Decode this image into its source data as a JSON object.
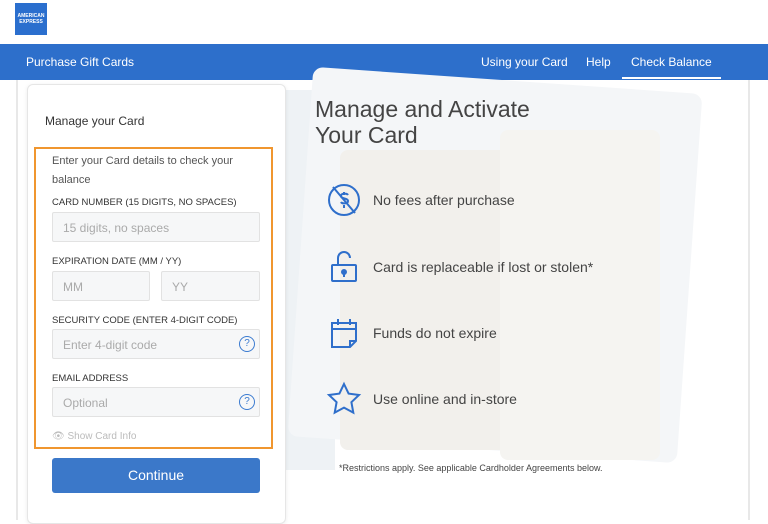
{
  "header": {
    "logo_text": "AMERICAN EXPRESS"
  },
  "nav": {
    "items": [
      "Purchase Gift Cards",
      "Using your Card",
      "Help",
      "Check Balance"
    ],
    "active": "Check Balance"
  },
  "form": {
    "title": "Manage your Card",
    "intro": "Enter your Card details to check your balance",
    "card_number_label": "CARD NUMBER (15 DIGITS, NO SPACES)",
    "card_number_placeholder": "15 digits, no spaces",
    "expiration_label": "EXPIRATION DATE (MM / YY)",
    "mm_placeholder": "MM",
    "yy_placeholder": "YY",
    "security_label": "SECURITY CODE (ENTER 4-DIGIT CODE)",
    "security_placeholder": "Enter 4-digit code",
    "email_label": "EMAIL ADDRESS",
    "email_placeholder": "Optional",
    "help_glyph": "?",
    "show_info": "Show Card Info",
    "continue": "Continue"
  },
  "hero": {
    "title": "Manage and Activate Your Card",
    "features": [
      {
        "icon": "no-fee-icon",
        "text": "No fees after purchase"
      },
      {
        "icon": "lock-icon",
        "text": "Card is replaceable if lost or stolen*"
      },
      {
        "icon": "calendar-icon",
        "text": "Funds do not expire"
      },
      {
        "icon": "star-icon",
        "text": "Use online and in-store"
      }
    ],
    "note": "*Restrictions apply. See applicable Cardholder Agreements below."
  },
  "colors": {
    "brand": "#2d6fcb",
    "highlight": "#f0962f",
    "button": "#3b78c9"
  }
}
